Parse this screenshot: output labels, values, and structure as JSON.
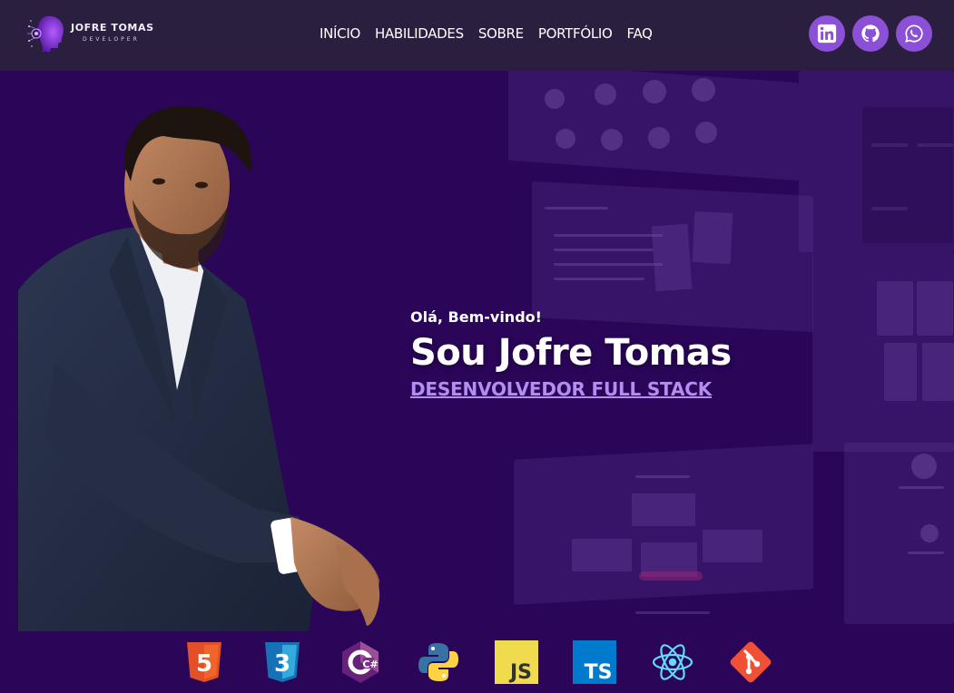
{
  "brand": {
    "name": "JOFRE TOMAS",
    "subtitle": "DEVELOPER",
    "logo": "brain-circuit-logo"
  },
  "nav": {
    "items": [
      {
        "label": "INÍCIO"
      },
      {
        "label": "HABILIDADES"
      },
      {
        "label": "SOBRE"
      },
      {
        "label": "PORTFÓLIO"
      },
      {
        "label": "FAQ"
      }
    ]
  },
  "socials": [
    {
      "icon": "linkedin-icon"
    },
    {
      "icon": "github-icon"
    },
    {
      "icon": "whatsapp-icon"
    }
  ],
  "hero": {
    "greeting": "Olá, Bem-vindo!",
    "headline": "Sou Jofre Tomas",
    "role": "DESENVOLVEDOR FULL STACK",
    "portrait": "developer-portrait-photo"
  },
  "tech": [
    {
      "icon": "html5-icon",
      "label": "5"
    },
    {
      "icon": "css3-icon",
      "label": "3"
    },
    {
      "icon": "csharp-icon",
      "label": "C#"
    },
    {
      "icon": "python-icon"
    },
    {
      "icon": "javascript-icon",
      "label": "JS"
    },
    {
      "icon": "typescript-icon",
      "label": "TS"
    },
    {
      "icon": "react-icon"
    },
    {
      "icon": "git-icon"
    }
  ],
  "colors": {
    "header_bg": "#2b1f3f",
    "hero_bg": "#2a0558",
    "accent": "#8c4fd8",
    "link": "#b78cf0"
  }
}
